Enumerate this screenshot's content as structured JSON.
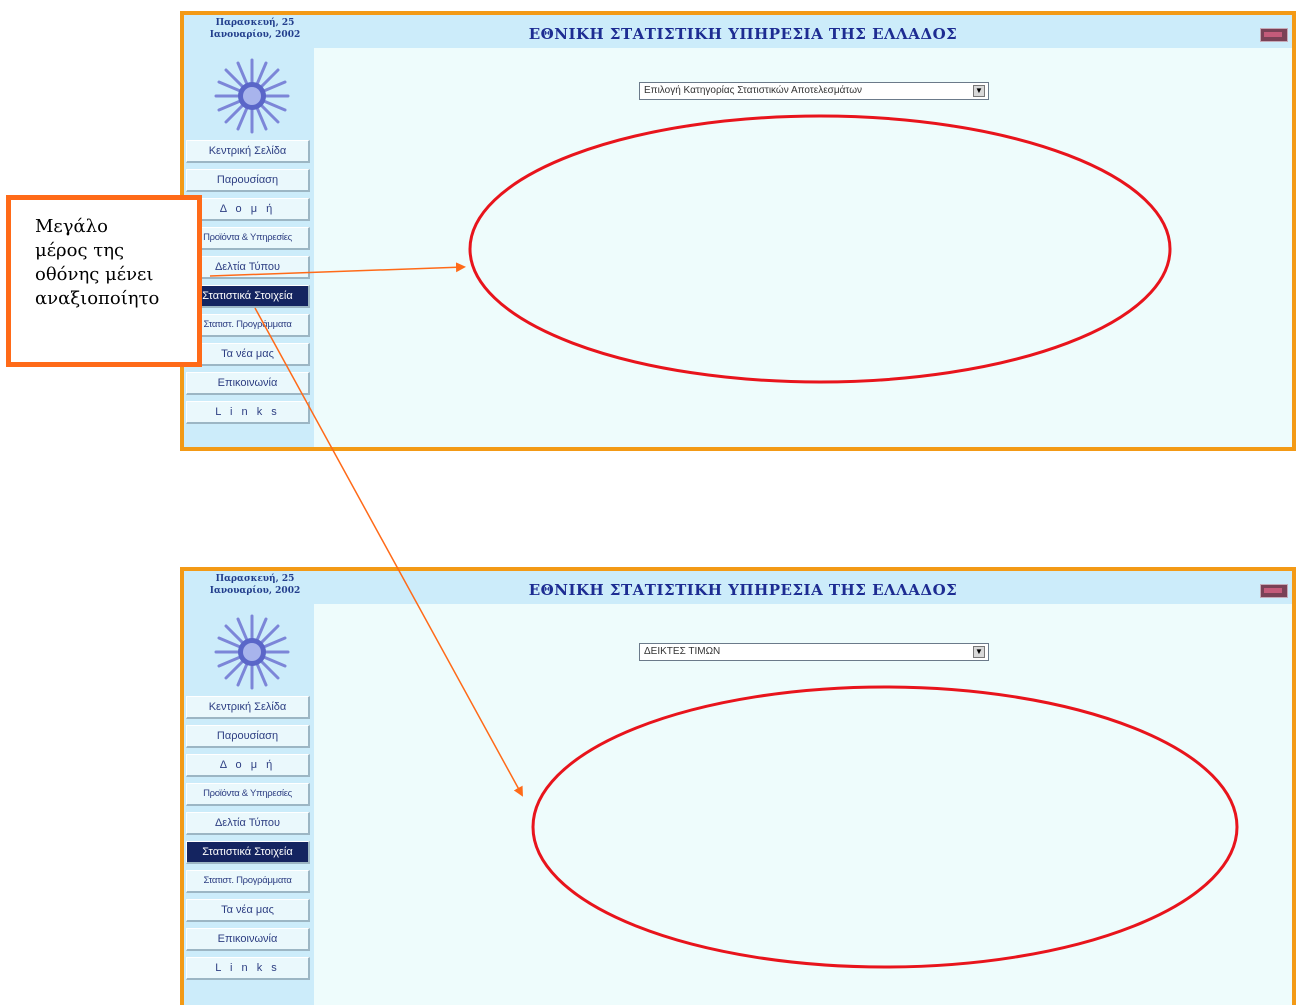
{
  "screens": [
    {
      "date": "Παρασκευή, 25 Ιανουαρίου, 2002",
      "title": "ΕΘΝΙΚΗ ΣΤΑΤΙΣΤΙΚΗ ΥΠΗΡΕΣΙΑ ΤΗΣ ΕΛΛΑΔΟΣ",
      "category_select": "Επιλογή Κατηγορίας Στατιστικών Αποτελεσμάτων"
    },
    {
      "date": "Παρασκευή, 25 Ιανουαρίου, 2002",
      "title": "ΕΘΝΙΚΗ ΣΤΑΤΙΣΤΙΚΗ ΥΠΗΡΕΣΙΑ ΤΗΣ ΕΛΛΑΔΟΣ",
      "category_select": "ΔΕΙΚΤΕΣ ΤΙΜΩΝ"
    }
  ],
  "nav": [
    "Κεντρική Σελίδα",
    "Παρουσίαση",
    "Δ ο μ ή",
    "Προϊόντα & Υπηρεσίες",
    "Δελτία Τύπου",
    "Στατιστικά Στοιχεία",
    "Στατιστ. Προγράμματα",
    "Τα νέα μας",
    "Επικοινωνία",
    "L i n k s"
  ],
  "active_nav": "Στατιστικά Στοιχεία",
  "annotation": "Μεγάλο\nμέρος της\nοθόνης μένει\nαναξιοποίητο",
  "colors": {
    "panel_border": "#f39a16",
    "header_bg": "#ccecfa",
    "content_bg": "#eefcfc",
    "title": "#1d2c92",
    "active_nav_bg": "#142460",
    "ellipse": "#e8141c",
    "arrow": "#ff6a18",
    "annotation_border": "#ff6a18"
  }
}
